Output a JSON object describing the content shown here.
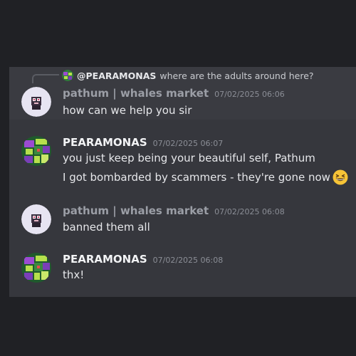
{
  "reply": {
    "mention": "@PEARAMONAS",
    "text": "where are the adults around here?"
  },
  "messages": [
    {
      "author": "pathum | whales market",
      "timestamp": "07/02/2025 06:06",
      "lines": [
        "how can we help you sir"
      ]
    },
    {
      "author": "PEARAMONAS",
      "timestamp": "07/02/2025 06:07",
      "lines": [
        "you just keep being your beautiful self, Pathum",
        "I got bombarded by scammers - they're gone now"
      ],
      "emoji": "grinning-squinting-face"
    },
    {
      "author": "pathum | whales market",
      "timestamp": "07/02/2025 06:08",
      "lines": [
        "banned them all"
      ]
    },
    {
      "author": "PEARAMONAS",
      "timestamp": "07/02/2025 06:08",
      "lines": [
        "thx!"
      ]
    }
  ],
  "colors": {
    "background": "#202125",
    "panel": "#36373d",
    "name_muted": "#9b9ea6",
    "name_bright": "#f2f3f5"
  }
}
